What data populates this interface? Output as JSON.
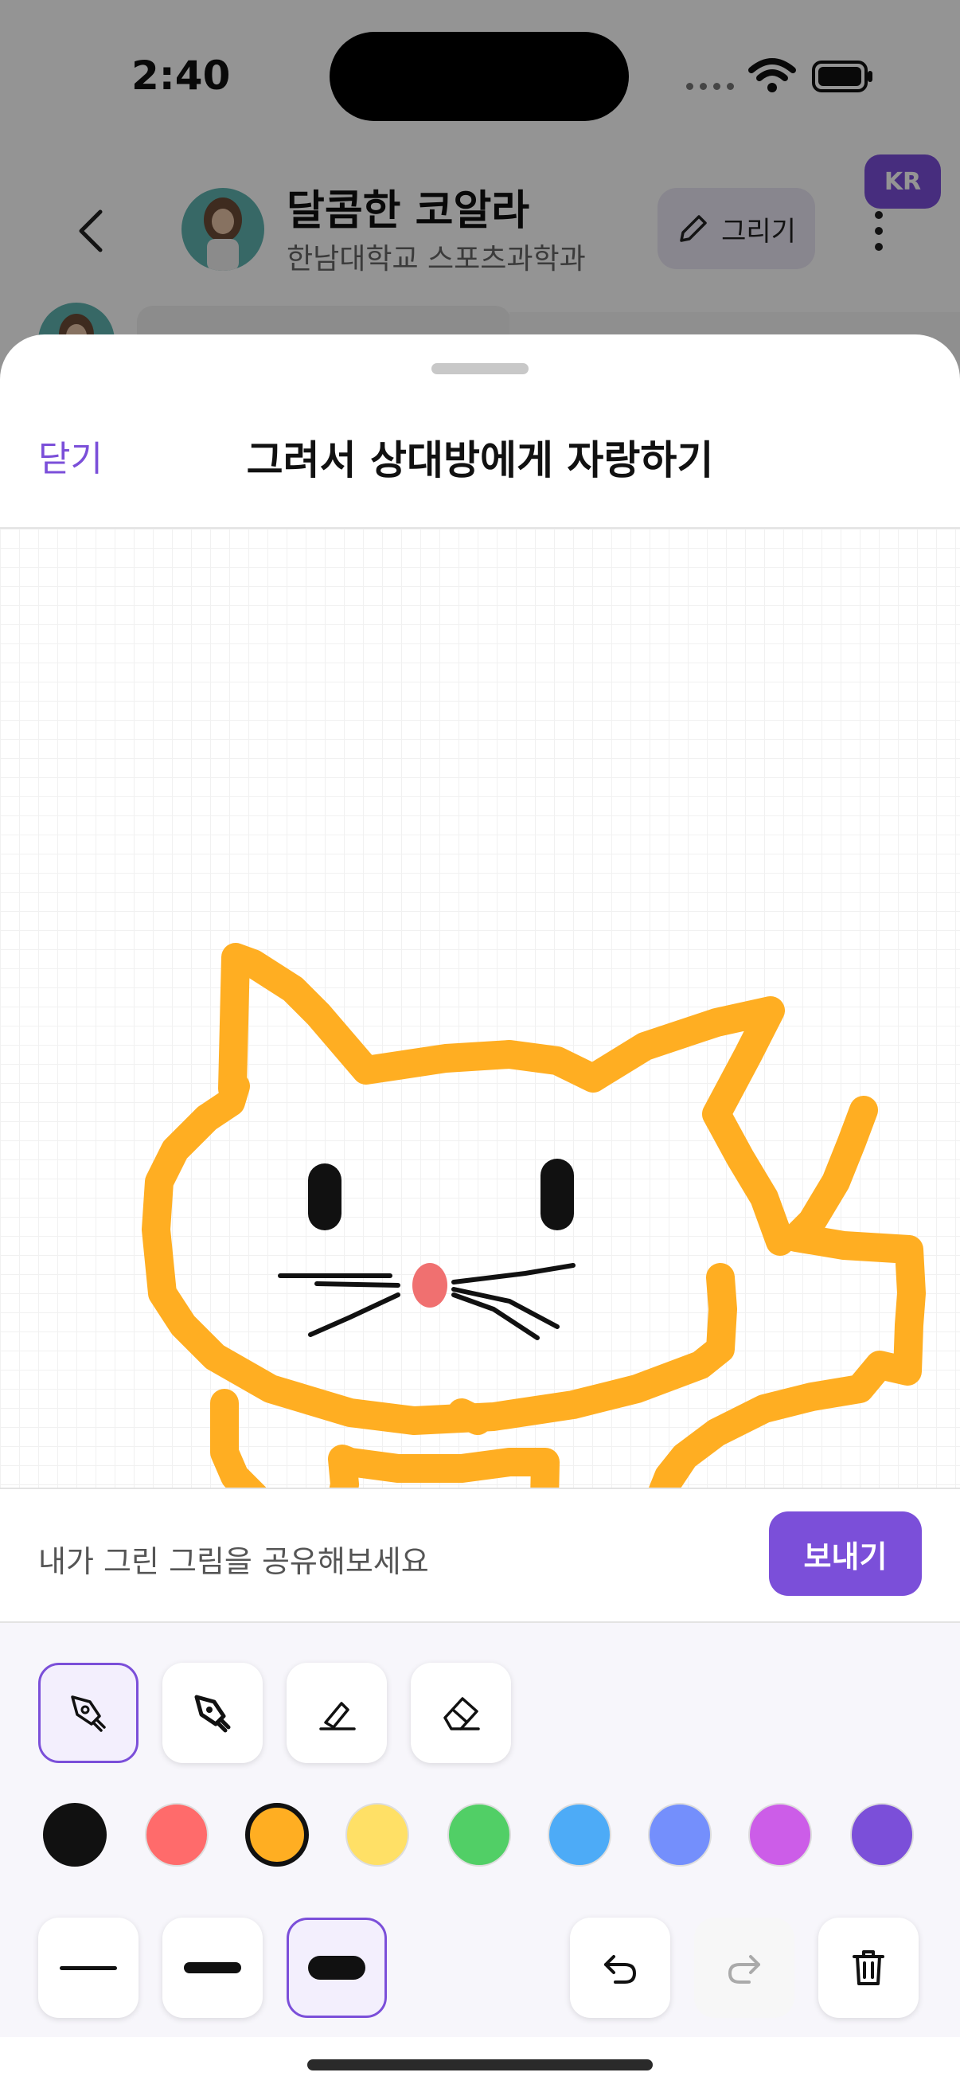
{
  "status_bar": {
    "time": "2:40"
  },
  "chat_header": {
    "name": "달콤한 코알라",
    "subtitle": "한남대학교 스포츠과학과",
    "draw_button_label": "그리기",
    "language_badge": "KR"
  },
  "sheet": {
    "close_label": "닫기",
    "title": "그려서 상대방에게 자랑하기",
    "share_prompt": "내가 그린 그림을 공유해보세요",
    "send_label": "보내기"
  },
  "tools": {
    "pens": [
      {
        "name": "pen-tool-1-icon",
        "selected": true
      },
      {
        "name": "pen-tool-2-icon",
        "selected": false
      },
      {
        "name": "highlighter-icon",
        "selected": false
      },
      {
        "name": "eraser-icon",
        "selected": false
      }
    ],
    "colors": [
      "#111111",
      "#ff6b6b",
      "#ffae22",
      "#ffe066",
      "#51cf66",
      "#4dabf7",
      "#748ffc",
      "#cc5de8",
      "#7b4fd9"
    ],
    "selected_color": "#ffae22",
    "stroke_widths": [
      "thin",
      "medium",
      "thick"
    ],
    "selected_stroke": "thick",
    "actions": [
      "undo-icon",
      "redo-icon",
      "trash-icon"
    ]
  },
  "colors": {
    "accent": "#7b4fd9",
    "drawing_orange": "#ffae22",
    "nose_pink": "#f07070"
  }
}
